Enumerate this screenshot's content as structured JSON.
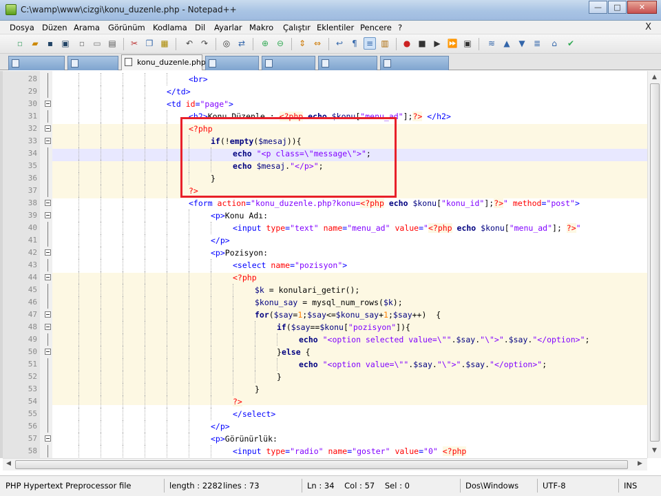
{
  "window": {
    "title": "C:\\wamp\\www\\cizgi\\konu_duzenle.php - Notepad++",
    "buttons": {
      "minimize": "—",
      "maximize": "□",
      "close": "✕"
    }
  },
  "menu": {
    "items": [
      "Dosya",
      "Düzen",
      "Arama",
      "Görünüm",
      "Kodlama",
      "Dil",
      "Ayarlar",
      "Makro",
      "Çalıştır",
      "Eklentiler",
      "Pencere",
      "?"
    ],
    "close": "X"
  },
  "toolbar": {
    "icons": [
      "new-file-icon",
      "open-file-icon",
      "save-icon",
      "save-all-icon",
      "close-icon",
      "close-all-icon",
      "print-icon",
      "cut-icon",
      "copy-icon",
      "paste-icon",
      "undo-icon",
      "redo-icon",
      "find-icon",
      "replace-icon",
      "zoom-in-icon",
      "zoom-out-icon",
      "sync-vertical-icon",
      "sync-horizontal-icon",
      "word-wrap-icon",
      "show-all-chars-icon",
      "indent-guide-icon",
      "user-lang-icon",
      "record-macro-icon",
      "stop-macro-icon",
      "play-macro-icon",
      "play-multiple-icon",
      "save-macro-icon",
      "trim-icon",
      "up-icon",
      "down-icon",
      "spell-check-icon",
      "spell-auto-icon"
    ]
  },
  "tabs": {
    "active_label": "konu_duzenle.php"
  },
  "editor": {
    "current_line": "34",
    "lines": [
      {
        "n": "28",
        "code": [
          {
            "c": "t-tag",
            "t": "<br>"
          }
        ],
        "indent": 6
      },
      {
        "n": "29",
        "code": [
          {
            "c": "t-tag",
            "t": "</td>"
          }
        ],
        "indent": 5
      },
      {
        "n": "30",
        "code": [
          {
            "c": "t-tag",
            "t": "<td "
          },
          {
            "c": "t-attr",
            "t": "id"
          },
          {
            "c": "t-tag",
            "t": "="
          },
          {
            "c": "t-str",
            "t": "\"page\""
          },
          {
            "c": "t-tag",
            "t": ">"
          }
        ],
        "indent": 5
      },
      {
        "n": "31",
        "code": [
          {
            "c": "t-tag",
            "t": "<h2>"
          },
          {
            "c": "",
            "t": "Konu Düzenle : "
          },
          {
            "c": "t-php",
            "t": "<?php"
          },
          {
            "c": "t-kw",
            "t": " echo "
          },
          {
            "c": "t-var",
            "t": "$konu"
          },
          {
            "c": "",
            "t": "["
          },
          {
            "c": "t-str",
            "t": "\"menu_ad\""
          },
          {
            "c": "",
            "t": "];"
          },
          {
            "c": "t-php",
            "t": "?>"
          },
          {
            "c": "t-tag",
            "t": " </h2>"
          }
        ],
        "indent": 6
      },
      {
        "n": "32",
        "code": [
          {
            "c": "t-php",
            "t": "<?php"
          }
        ],
        "indent": 6
      },
      {
        "n": "33",
        "code": [
          {
            "c": "t-kw",
            "t": "if"
          },
          {
            "c": "",
            "t": "(!"
          },
          {
            "c": "t-kw",
            "t": "empty"
          },
          {
            "c": "",
            "t": "("
          },
          {
            "c": "t-var",
            "t": "$mesaj"
          },
          {
            "c": "",
            "t": ")){"
          }
        ],
        "indent": 7
      },
      {
        "n": "34",
        "code": [
          {
            "c": "t-kw",
            "t": "echo "
          },
          {
            "c": "t-str",
            "t": "\"<p class=\\\"message\\\">\""
          },
          {
            "c": "",
            "t": ";"
          }
        ],
        "indent": 8
      },
      {
        "n": "35",
        "code": [
          {
            "c": "t-kw",
            "t": "echo "
          },
          {
            "c": "t-var",
            "t": "$mesaj"
          },
          {
            "c": "",
            "t": "."
          },
          {
            "c": "t-str",
            "t": "\"</p>\""
          },
          {
            "c": "",
            "t": ";"
          }
        ],
        "indent": 8
      },
      {
        "n": "36",
        "code": [
          {
            "c": "",
            "t": "}"
          }
        ],
        "indent": 7
      },
      {
        "n": "37",
        "code": [
          {
            "c": "t-php",
            "t": "?>"
          }
        ],
        "indent": 6
      },
      {
        "n": "38",
        "code": [
          {
            "c": "t-tag",
            "t": "<form "
          },
          {
            "c": "t-attr",
            "t": "action"
          },
          {
            "c": "t-tag",
            "t": "="
          },
          {
            "c": "t-str",
            "t": "\"konu_duzenle.php?konu="
          },
          {
            "c": "t-php",
            "t": "<?php"
          },
          {
            "c": "t-kw",
            "t": " echo "
          },
          {
            "c": "t-var",
            "t": "$konu"
          },
          {
            "c": "",
            "t": "["
          },
          {
            "c": "t-str",
            "t": "\"konu_id\""
          },
          {
            "c": "",
            "t": "];"
          },
          {
            "c": "t-php",
            "t": "?>"
          },
          {
            "c": "t-str",
            "t": "\" "
          },
          {
            "c": "t-attr",
            "t": "method"
          },
          {
            "c": "t-tag",
            "t": "="
          },
          {
            "c": "t-str",
            "t": "\"post\""
          },
          {
            "c": "t-tag",
            "t": ">"
          }
        ],
        "indent": 6
      },
      {
        "n": "39",
        "code": [
          {
            "c": "t-tag",
            "t": "<p>"
          },
          {
            "c": "",
            "t": "Konu Adı:"
          }
        ],
        "indent": 7
      },
      {
        "n": "40",
        "code": [
          {
            "c": "t-tag",
            "t": "<input "
          },
          {
            "c": "t-attr",
            "t": "type"
          },
          {
            "c": "t-tag",
            "t": "="
          },
          {
            "c": "t-str",
            "t": "\"text\" "
          },
          {
            "c": "t-attr",
            "t": "name"
          },
          {
            "c": "t-tag",
            "t": "="
          },
          {
            "c": "t-str",
            "t": "\"menu_ad\" "
          },
          {
            "c": "t-attr",
            "t": "value"
          },
          {
            "c": "t-tag",
            "t": "="
          },
          {
            "c": "t-str",
            "t": "\""
          },
          {
            "c": "t-php",
            "t": "<?php"
          },
          {
            "c": "t-kw",
            "t": " echo "
          },
          {
            "c": "t-var",
            "t": "$konu"
          },
          {
            "c": "",
            "t": "["
          },
          {
            "c": "t-str",
            "t": "\"menu_ad\""
          },
          {
            "c": "",
            "t": "]; "
          },
          {
            "c": "t-php",
            "t": "?>"
          },
          {
            "c": "t-str",
            "t": "\" "
          }
        ],
        "indent": 8
      },
      {
        "n": "41",
        "code": [
          {
            "c": "t-tag",
            "t": "</p>"
          }
        ],
        "indent": 7
      },
      {
        "n": "42",
        "code": [
          {
            "c": "t-tag",
            "t": "<p>"
          },
          {
            "c": "",
            "t": "Pozisyon:"
          }
        ],
        "indent": 7
      },
      {
        "n": "43",
        "code": [
          {
            "c": "t-tag",
            "t": "<select "
          },
          {
            "c": "t-attr",
            "t": "name"
          },
          {
            "c": "t-tag",
            "t": "="
          },
          {
            "c": "t-str",
            "t": "\"pozisyon\""
          },
          {
            "c": "t-tag",
            "t": ">"
          }
        ],
        "indent": 8
      },
      {
        "n": "44",
        "code": [
          {
            "c": "t-php",
            "t": "<?php"
          }
        ],
        "indent": 8
      },
      {
        "n": "45",
        "code": [
          {
            "c": "t-var",
            "t": "$k"
          },
          {
            "c": "",
            "t": " = konulari_getir();"
          }
        ],
        "indent": 9
      },
      {
        "n": "46",
        "code": [
          {
            "c": "t-var",
            "t": "$konu_say"
          },
          {
            "c": "",
            "t": " = mysql_num_rows("
          },
          {
            "c": "t-var",
            "t": "$k"
          },
          {
            "c": "",
            "t": ");"
          }
        ],
        "indent": 9
      },
      {
        "n": "47",
        "code": [
          {
            "c": "t-kw",
            "t": "for"
          },
          {
            "c": "",
            "t": "("
          },
          {
            "c": "t-var",
            "t": "$say"
          },
          {
            "c": "",
            "t": "="
          },
          {
            "c": "t-num",
            "t": "1"
          },
          {
            "c": "",
            "t": ";"
          },
          {
            "c": "t-var",
            "t": "$say"
          },
          {
            "c": "",
            "t": "<="
          },
          {
            "c": "t-var",
            "t": "$konu_say"
          },
          {
            "c": "",
            "t": "+"
          },
          {
            "c": "t-num",
            "t": "1"
          },
          {
            "c": "",
            "t": ";"
          },
          {
            "c": "t-var",
            "t": "$say"
          },
          {
            "c": "",
            "t": "++)  {"
          }
        ],
        "indent": 9
      },
      {
        "n": "48",
        "code": [
          {
            "c": "t-kw",
            "t": "if"
          },
          {
            "c": "",
            "t": "("
          },
          {
            "c": "t-var",
            "t": "$say"
          },
          {
            "c": "",
            "t": "=="
          },
          {
            "c": "t-var",
            "t": "$konu"
          },
          {
            "c": "",
            "t": "["
          },
          {
            "c": "t-str",
            "t": "\"pozisyon\""
          },
          {
            "c": "",
            "t": "]){"
          }
        ],
        "indent": 10
      },
      {
        "n": "49",
        "code": [
          {
            "c": "t-kw",
            "t": "echo "
          },
          {
            "c": "t-str",
            "t": "\"<option selected value=\\\"\""
          },
          {
            "c": "",
            "t": "."
          },
          {
            "c": "t-var",
            "t": "$say"
          },
          {
            "c": "",
            "t": "."
          },
          {
            "c": "t-str",
            "t": "\"\\\">\""
          },
          {
            "c": "",
            "t": "."
          },
          {
            "c": "t-var",
            "t": "$say"
          },
          {
            "c": "",
            "t": "."
          },
          {
            "c": "t-str",
            "t": "\"</option>\""
          },
          {
            "c": "",
            "t": ";"
          }
        ],
        "indent": 11
      },
      {
        "n": "50",
        "code": [
          {
            "c": "",
            "t": "}"
          },
          {
            "c": "t-kw",
            "t": "else"
          },
          {
            "c": "",
            "t": " {"
          }
        ],
        "indent": 10
      },
      {
        "n": "51",
        "code": [
          {
            "c": "t-kw",
            "t": "echo "
          },
          {
            "c": "t-str",
            "t": "\"<option value=\\\"\""
          },
          {
            "c": "",
            "t": "."
          },
          {
            "c": "t-var",
            "t": "$say"
          },
          {
            "c": "",
            "t": "."
          },
          {
            "c": "t-str",
            "t": "\"\\\">\""
          },
          {
            "c": "",
            "t": "."
          },
          {
            "c": "t-var",
            "t": "$say"
          },
          {
            "c": "",
            "t": "."
          },
          {
            "c": "t-str",
            "t": "\"</option>\""
          },
          {
            "c": "",
            "t": ";"
          }
        ],
        "indent": 11
      },
      {
        "n": "52",
        "code": [
          {
            "c": "",
            "t": "}"
          }
        ],
        "indent": 10
      },
      {
        "n": "53",
        "code": [
          {
            "c": "",
            "t": "}"
          }
        ],
        "indent": 9
      },
      {
        "n": "54",
        "code": [
          {
            "c": "t-php",
            "t": "?>"
          }
        ],
        "indent": 8
      },
      {
        "n": "55",
        "code": [
          {
            "c": "t-tag",
            "t": "</select>"
          }
        ],
        "indent": 8
      },
      {
        "n": "56",
        "code": [
          {
            "c": "t-tag",
            "t": "</p>"
          }
        ],
        "indent": 7
      },
      {
        "n": "57",
        "code": [
          {
            "c": "t-tag",
            "t": "<p>"
          },
          {
            "c": "",
            "t": "Görünürlük:"
          }
        ],
        "indent": 7
      },
      {
        "n": "58",
        "code": [
          {
            "c": "t-tag",
            "t": "<input "
          },
          {
            "c": "t-attr",
            "t": "type"
          },
          {
            "c": "t-tag",
            "t": "="
          },
          {
            "c": "t-str",
            "t": "\"radio\" "
          },
          {
            "c": "t-attr",
            "t": "name"
          },
          {
            "c": "t-tag",
            "t": "="
          },
          {
            "c": "t-str",
            "t": "\"goster\" "
          },
          {
            "c": "t-attr",
            "t": "value"
          },
          {
            "c": "t-tag",
            "t": "="
          },
          {
            "c": "t-str",
            "t": "\"0\" "
          },
          {
            "c": "t-php",
            "t": "<?php"
          }
        ],
        "indent": 8
      }
    ]
  },
  "statusbar": {
    "file_type": "PHP Hypertext Preprocessor file",
    "length": "length : 2282",
    "lines": "lines : 73",
    "position": "Ln : 34    Col : 57    Sel : 0",
    "eol": "Dos\\Windows",
    "encoding": "UTF-8",
    "mode": "INS"
  },
  "colors": {
    "highlight_box": "#e8202a",
    "current_line": "#e8e8ff",
    "tag": "#0000ff",
    "attribute": "#ff0000",
    "string": "#8000ff"
  }
}
